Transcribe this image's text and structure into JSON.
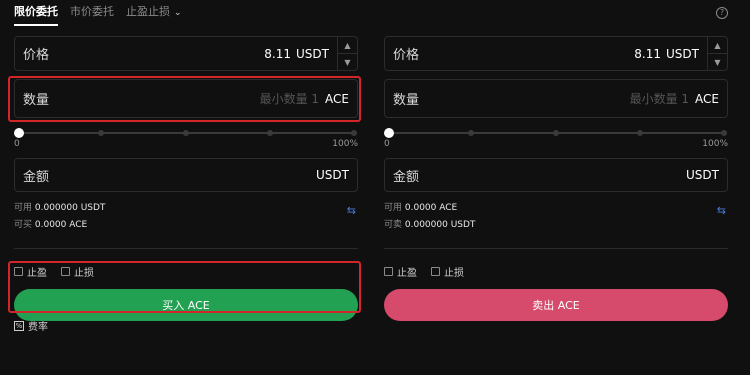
{
  "tabs": {
    "limit": "限价委托",
    "market": "市价委托",
    "tpsl": "止盈止损"
  },
  "help_icon": "question-circle-icon",
  "buy": {
    "price_label": "价格",
    "price_value": "8.11",
    "price_unit": "USDT",
    "qty_label": "数量",
    "qty_placeholder": "最小数量 1",
    "qty_unit": "ACE",
    "slider_min": "0",
    "slider_max": "100%",
    "slider_value_percent": 0,
    "amount_label": "金额",
    "amount_unit": "USDT",
    "avail_label": "可用",
    "avail_value": "0.000000 USDT",
    "can_label": "可买",
    "can_value": "0.0000 ACE",
    "tp_label": "止盈",
    "sl_label": "止损",
    "button_label": "买入 ACE"
  },
  "sell": {
    "price_label": "价格",
    "price_value": "8.11",
    "price_unit": "USDT",
    "qty_label": "数量",
    "qty_placeholder": "最小数量 1",
    "qty_unit": "ACE",
    "slider_min": "0",
    "slider_max": "100%",
    "slider_value_percent": 0,
    "amount_label": "金额",
    "amount_unit": "USDT",
    "avail_label": "可用",
    "avail_value": "0.0000 ACE",
    "can_label": "可卖",
    "can_value": "0.000000 USDT",
    "tp_label": "止盈",
    "sl_label": "止损",
    "button_label": "卖出 ACE"
  },
  "fee_label": "费率",
  "colors": {
    "buy": "#23a152",
    "sell": "#d64a6c",
    "highlight": "#d3262a",
    "swap": "#4a7bd8"
  }
}
